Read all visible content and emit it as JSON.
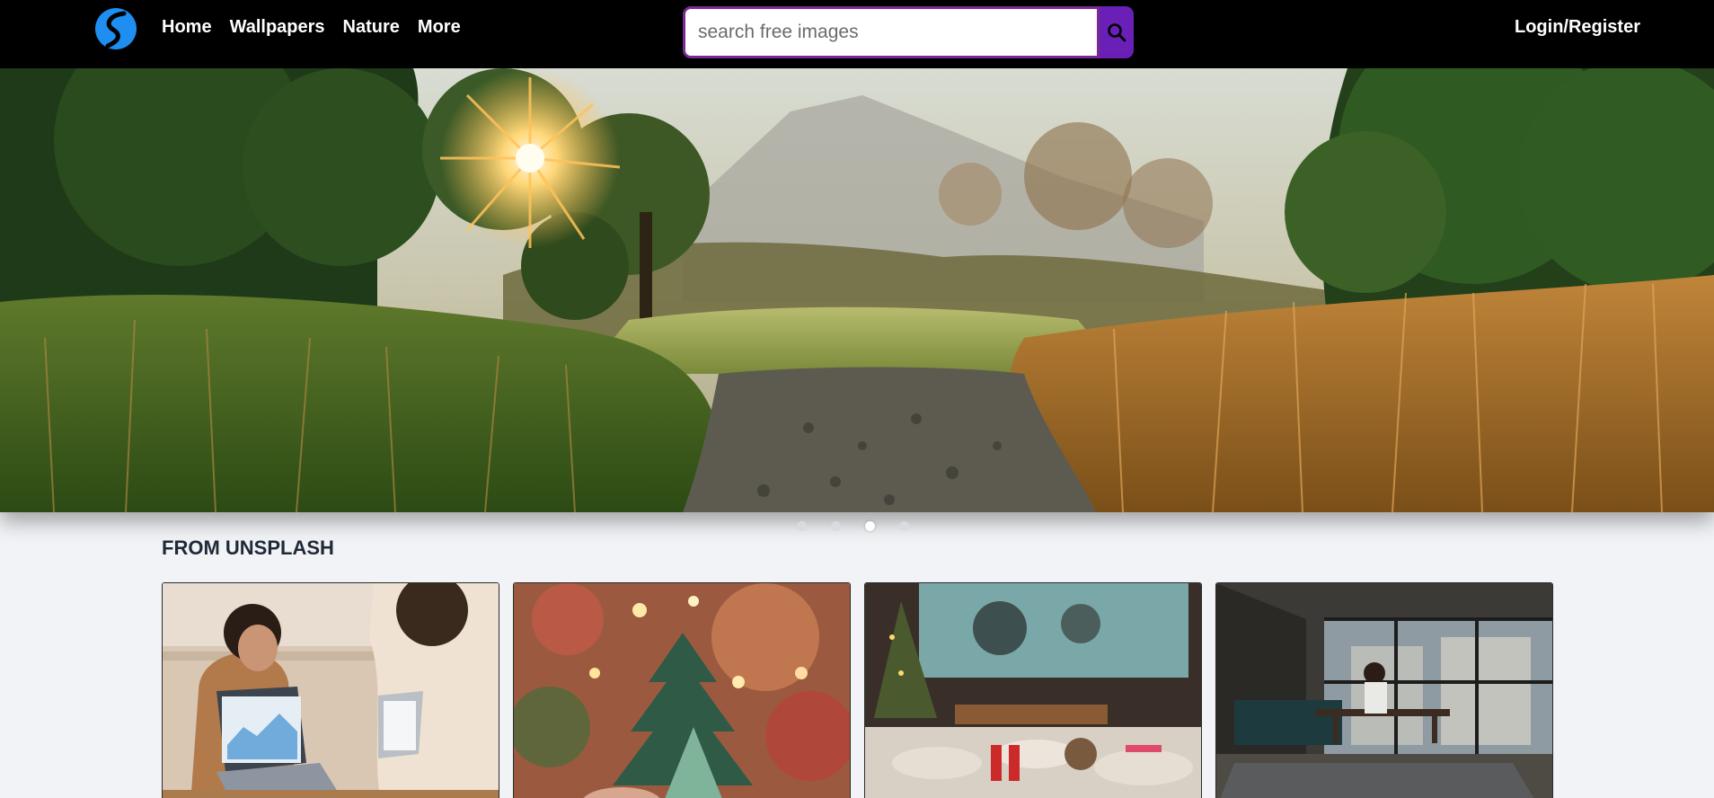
{
  "nav": {
    "links": [
      "Home",
      "Wallpapers",
      "Nature",
      "More"
    ],
    "login": "Login/Register"
  },
  "search": {
    "placeholder": "search free images",
    "value": ""
  },
  "hero": {
    "slides": 4,
    "active_slide": 3
  },
  "section": {
    "title": "FROM UNSPLASH"
  },
  "colors": {
    "accent": "#6a1fb7",
    "search_border": "#7b2a92",
    "logo": "#1e8ff0",
    "nav_bg": "#000000"
  },
  "icons": {
    "logo": "brand-logo-icon",
    "search": "search-icon"
  }
}
